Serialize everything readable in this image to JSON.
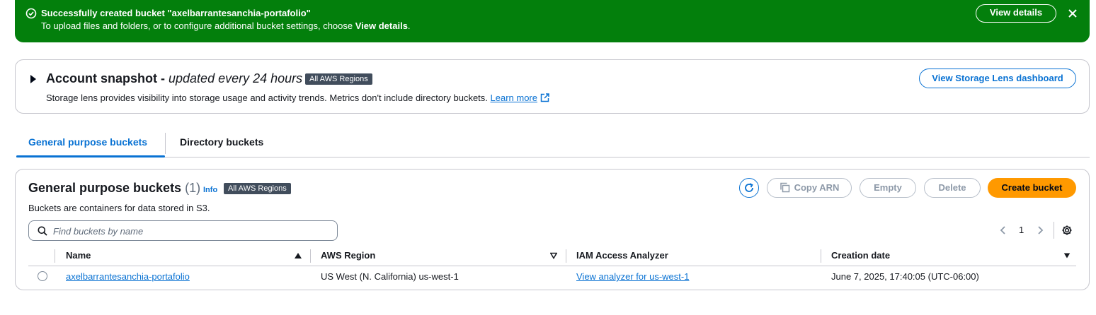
{
  "flash": {
    "title": "Successfully created bucket \"axelbarrantesanchia-portafolio\"",
    "message_pre": "To upload files and folders, or to configure additional bucket settings, choose ",
    "message_bold": "View details",
    "message_post": ".",
    "view_details_label": "View details",
    "icons": {
      "status": "check-circle-icon",
      "close": "close-icon"
    },
    "color": "#037f0c"
  },
  "snapshot": {
    "title": "Account snapshot - ",
    "title_italic": "updated every 24 hours",
    "region_badge": "All AWS Regions",
    "description": "Storage lens provides visibility into storage usage and activity trends. Metrics don't include directory buckets. ",
    "learn_more": "Learn more",
    "dashboard_button": "View Storage Lens dashboard"
  },
  "tabs": [
    {
      "label": "General purpose buckets",
      "active": true
    },
    {
      "label": "Directory buckets",
      "active": false
    }
  ],
  "buckets_panel": {
    "title": "General purpose buckets",
    "count": "(1)",
    "info": "Info",
    "region_badge": "All AWS Regions",
    "description": "Buckets are containers for data stored in S3.",
    "actions": {
      "copy_arn": "Copy ARN",
      "empty": "Empty",
      "delete": "Delete",
      "create": "Create bucket"
    },
    "search_placeholder": "Find buckets by name",
    "pagination": {
      "page": "1"
    },
    "columns": [
      "Name",
      "AWS Region",
      "IAM Access Analyzer",
      "Creation date"
    ],
    "rows": [
      {
        "name": "axelbarrantesanchia-portafolio",
        "region": "US West (N. California) us-west-1",
        "analyzer": "View analyzer for us-west-1",
        "created": "June 7, 2025, 17:40:05 (UTC-06:00)"
      }
    ]
  },
  "colors": {
    "accent": "#0972d3",
    "primary_button": "#ff9900",
    "badge": "#414d5c",
    "border": "#c6c6cd"
  }
}
